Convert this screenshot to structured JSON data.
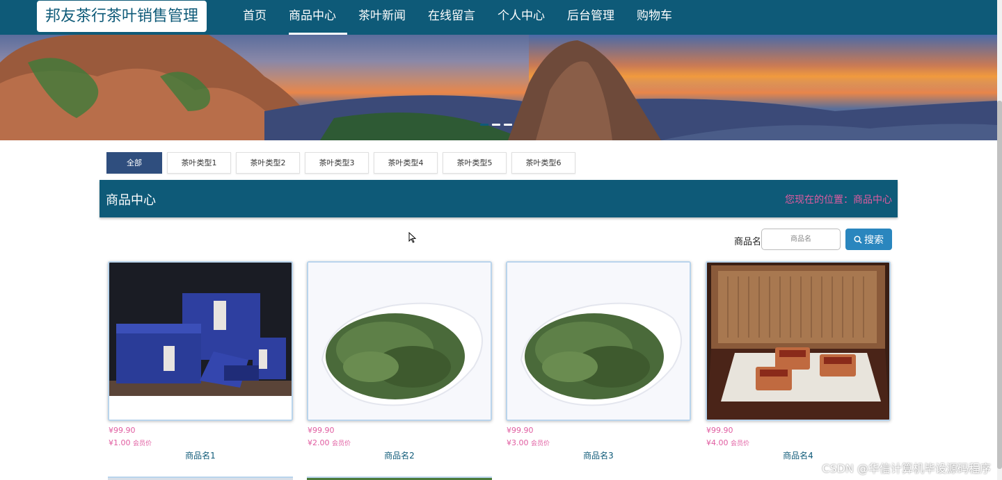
{
  "header": {
    "logo_text": "邦友茶行茶叶销售管理",
    "nav": [
      "首页",
      "商品中心",
      "茶叶新闻",
      "在线留言",
      "个人中心",
      "后台管理",
      "购物车"
    ],
    "active_nav": "商品中心"
  },
  "banner": {
    "slides": 3,
    "active_slide": 1
  },
  "category_tabs": [
    "全部",
    "茶叶类型1",
    "茶叶类型2",
    "茶叶类型3",
    "茶叶类型4",
    "茶叶类型5",
    "茶叶类型6"
  ],
  "section": {
    "title": "商品中心",
    "breadcrumb": "您现在的位置：商品中心"
  },
  "search": {
    "label": "商品名",
    "placeholder": "商品名",
    "button_label": "搜索"
  },
  "products": [
    {
      "name": "商品名1",
      "price": "¥99.90",
      "vip_price": "¥1.00",
      "vip_label": "会员价",
      "image": "tea-gift-box"
    },
    {
      "name": "商品名2",
      "price": "¥99.90",
      "vip_price": "¥2.00",
      "vip_label": "会员价",
      "image": "green-tea-bowl"
    },
    {
      "name": "商品名3",
      "price": "¥99.90",
      "vip_price": "¥3.00",
      "vip_label": "会员价",
      "image": "green-tea-bowl"
    },
    {
      "name": "商品名4",
      "price": "¥99.90",
      "vip_price": "¥4.00",
      "vip_label": "会员价",
      "image": "wooden-tea-box"
    }
  ],
  "watermark": "CSDN @华信计算机毕设源码程序",
  "colors": {
    "primary": "#0e5a78",
    "accent_pink": "#e05ca0",
    "button_blue": "#2a86be",
    "tab_active": "#2f4e7e"
  }
}
